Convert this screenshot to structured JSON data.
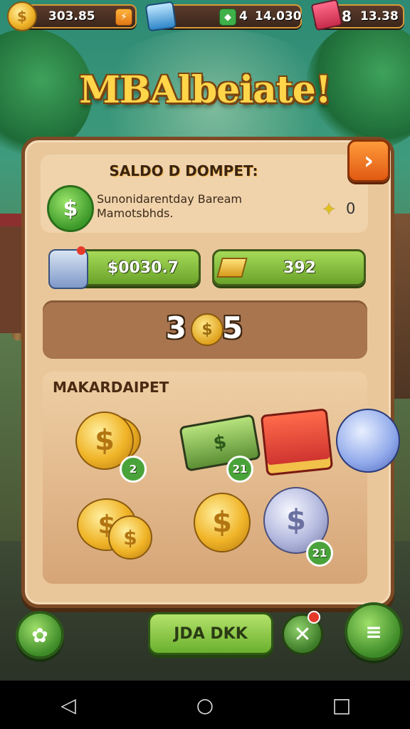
{
  "resources": [
    {
      "value": "303.85",
      "badge": "⚡"
    },
    {
      "value": "14.030",
      "badge": "4"
    },
    {
      "value": "13.38",
      "badge": "8"
    }
  ],
  "title": "MBAlbeiate!",
  "next_symbol": "›",
  "saldo": {
    "title": "SALDO D DOMPET:",
    "description_line1": "Sunonidarentday Baream",
    "description_line2": "Mamotsbhds.",
    "star_value": "0"
  },
  "balances": {
    "cash": "$0030.7",
    "gold": "392"
  },
  "counter": {
    "left": "3",
    "right": "5"
  },
  "shop": {
    "title": "MAKARDAIPET",
    "items": [
      {
        "badge": "2"
      },
      {
        "badge": "21"
      },
      {
        "badge": ""
      },
      {
        "badge": ""
      },
      {
        "badge": "21"
      }
    ]
  },
  "bottom": {
    "main_label": "JDA DKK",
    "menu_symbol": "≡",
    "close_symbol": "✕"
  },
  "nav": {
    "back": "◁",
    "home": "○",
    "recents": "□"
  },
  "colors": {
    "accent_green": "#6ab02e",
    "panel": "#e9c79b",
    "orange": "#e05a12"
  }
}
